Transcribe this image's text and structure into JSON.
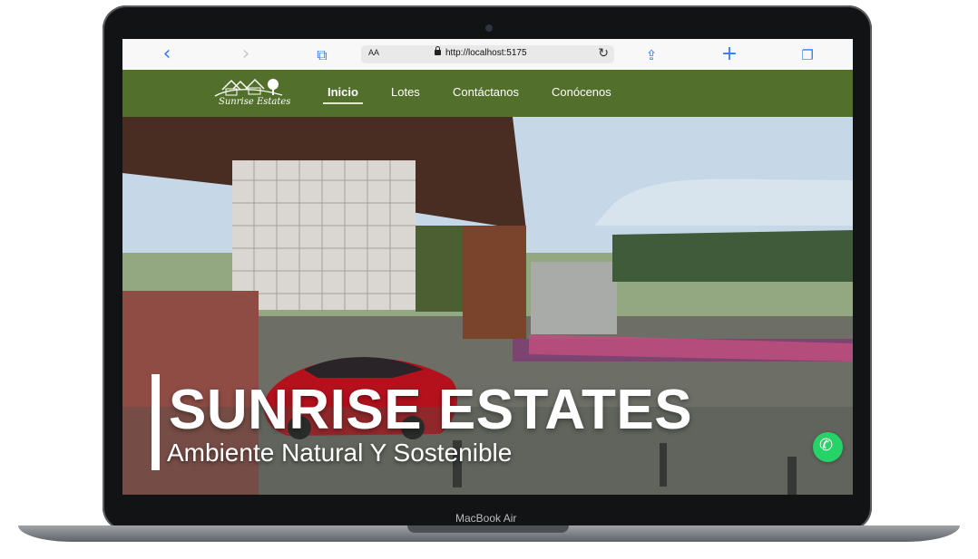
{
  "device": {
    "label": "MacBook Air"
  },
  "browser": {
    "address_prefix": "AA",
    "url": "http://localhost:5175",
    "icons": [
      "back-icon",
      "forward-icon",
      "book-icon",
      "lock-icon",
      "reload-icon",
      "share-icon",
      "new-tab-icon",
      "tabs-icon"
    ]
  },
  "site": {
    "logo_text": "Sunrise Estates",
    "nav": [
      {
        "label": "Inicio"
      },
      {
        "label": "Lotes"
      },
      {
        "label": "Contáctanos"
      },
      {
        "label": "Conócenos"
      }
    ],
    "nav_color": "#52702b"
  },
  "hero": {
    "title": "SUNRISE ESTATES",
    "subtitle": "Ambiente Natural Y Sostenible"
  },
  "floating": {
    "icon": "whatsapp-icon",
    "color": "#25d366"
  }
}
